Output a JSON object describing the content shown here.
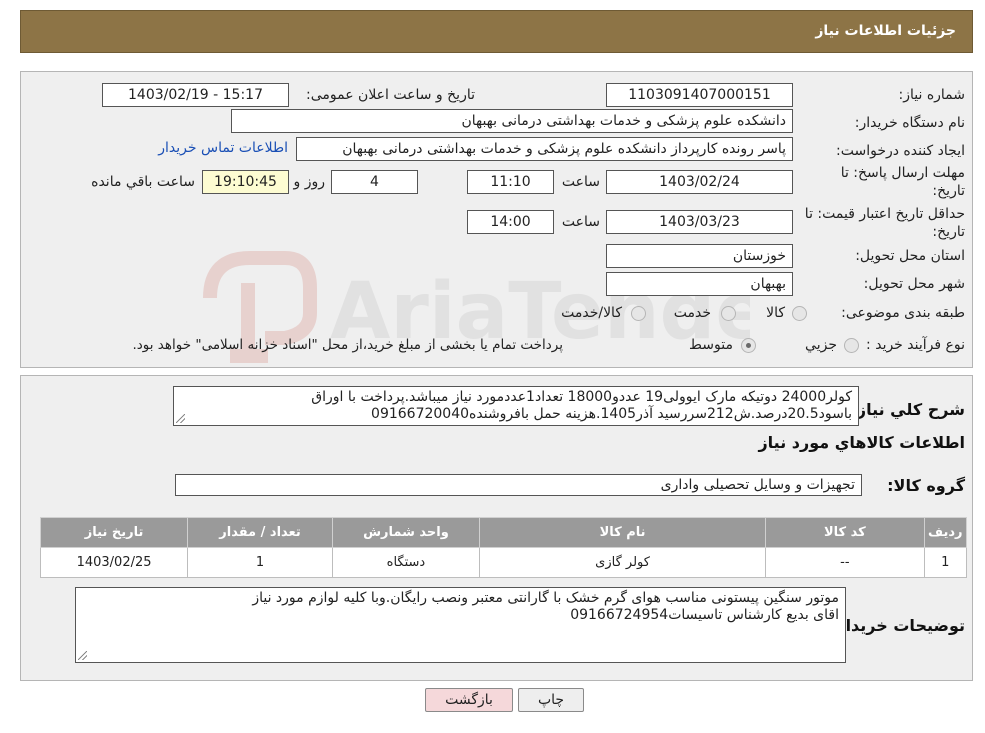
{
  "header": {
    "title": "جزئیات اطلاعات نیاز"
  },
  "form": {
    "need_number_label": "شماره نیاز:",
    "need_number": "1103091407000151",
    "announce_label": "تاریخ و ساعت اعلان عمومی:",
    "announce_value": "1403/02/19 - 15:17",
    "buyer_org_label": "نام دستگاه خریدار:",
    "buyer_org": "دانشکده علوم پزشکی و خدمات بهداشتی  درمانی بهبهان",
    "creator_label": "ایجاد کننده درخواست:",
    "creator": "پاسر رونده کارپرداز دانشکده علوم پزشکی و خدمات بهداشتی  درمانی بهبهان",
    "contact_link": "اطلاعات تماس خریدار",
    "deadline_label_1": "مهلت ارسال پاسخ: تا",
    "deadline_label_2": "تاریخ:",
    "deadline_date": "1403/02/24",
    "time_word": "ساعت",
    "deadline_time": "11:10",
    "days_count": "4",
    "days_word": "روز و",
    "remaining_time": "19:10:45",
    "remaining_word": "ساعت باقي مانده",
    "validity_label_1": "حداقل تاریخ اعتبار قیمت: تا",
    "validity_label_2": "تاریخ:",
    "validity_date": "1403/03/23",
    "validity_time": "14:00",
    "province_label": "استان محل تحویل:",
    "province": "خوزستان",
    "city_label": "شهر محل تحویل:",
    "city": "بهبهان",
    "category_label": "طبقه بندی موضوعی:",
    "category_options": [
      "کالا",
      "خدمت",
      "کالا/خدمت"
    ],
    "process_label": "نوع فرآیند خرید :",
    "process_options": [
      "جزیي",
      "متوسط"
    ],
    "process_note": "پرداخت تمام یا بخشی از مبلغ خرید،از محل \"اسناد خزانه اسلامی\" خواهد بود."
  },
  "details": {
    "general_desc_label": "شرح کلي نیاز:",
    "general_desc_line1": "کولر24000 دوتیکه مارک ایوولی19 عددو18000 تعداد1عددمورد نیاز میباشد.پرداخت با اوراق",
    "general_desc_line2": "باسود20.5درصد.ش212سررسید آذر1405.هزینه حمل بافروشنده09166720040",
    "items_heading": "اطلاعات کالاهاي مورد نیاز",
    "group_label": "گروه کالا:",
    "group_value": "تجهیزات و وسایل تحصیلی واداری",
    "table_headers": [
      "ردیف",
      "کد کالا",
      "نام کالا",
      "واحد شمارش",
      "تعداد / مقدار",
      "تاریخ نیاز"
    ],
    "table_rows": [
      [
        "1",
        "--",
        "کولر گازی",
        "دستگاه",
        "1",
        "1403/02/25"
      ]
    ],
    "buyer_notes_label": "توضیحات خریدار:",
    "buyer_notes_line1": "موتور سنگین پیستونی مناسب هوای گرم خشک با گارانتی معتبر ونصب رایگان.وبا کلیه لوازم مورد نیاز",
    "buyer_notes_line2": "اقای بدیع کارشناس تاسیسات09166724954"
  },
  "buttons": {
    "print": "چاپ",
    "back": "بازگشت"
  },
  "watermark": {
    "text": "AriaTender.neT"
  },
  "colors": {
    "header_bg": "#8d7446",
    "link": "#1a4fb5",
    "table_header": "#9a9a9a",
    "back_button": "#f5d8da"
  }
}
